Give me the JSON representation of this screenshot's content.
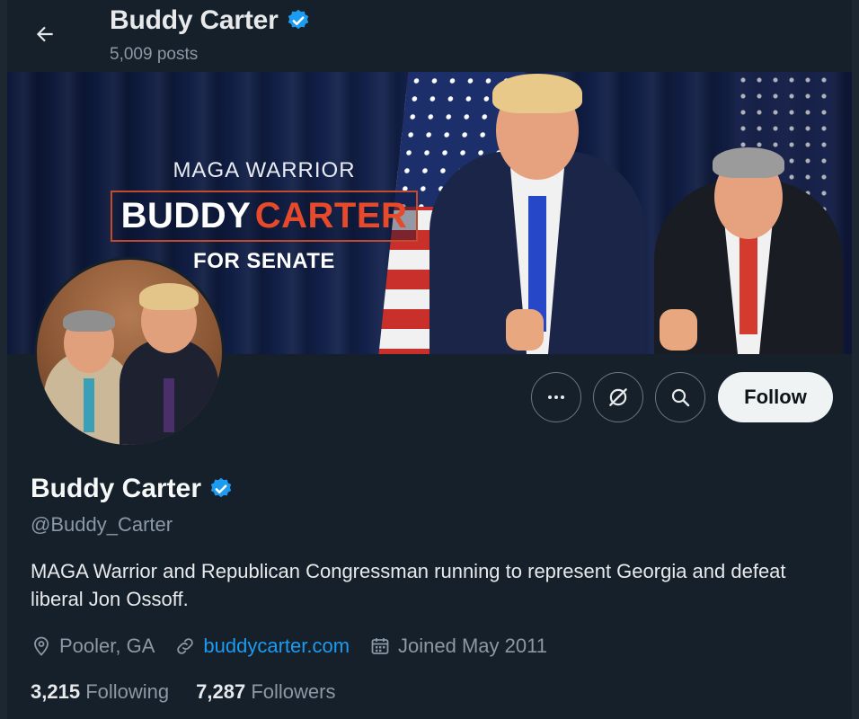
{
  "header": {
    "name": "Buddy Carter",
    "posts": "5,009 posts"
  },
  "banner": {
    "tagline": "MAGA WARRIOR",
    "name_first": "BUDDY",
    "name_last": "CARTER",
    "subline": "FOR SENATE"
  },
  "actions": {
    "follow_label": "Follow"
  },
  "profile": {
    "display_name": "Buddy Carter",
    "handle": "@Buddy_Carter",
    "bio": "MAGA Warrior and Republican Congressman running to represent Georgia and defeat liberal Jon Ossoff.",
    "location": "Pooler, GA",
    "website": "buddycarter.com",
    "joined": "Joined May 2011",
    "following_count": "3,215",
    "following_label": "Following",
    "followers_count": "7,287",
    "followers_label": "Followers"
  },
  "icons": {
    "back": "back-arrow-icon",
    "verified": "verified-badge-icon",
    "more": "more-icon",
    "grok": "grok-icon",
    "search": "search-icon",
    "location": "location-pin-icon",
    "link": "link-icon",
    "calendar": "calendar-icon"
  },
  "colors": {
    "background": "#15202b",
    "accent": "#1d9bf0",
    "verified": "#1d9bf0",
    "banner_accent": "#e64a2a"
  }
}
